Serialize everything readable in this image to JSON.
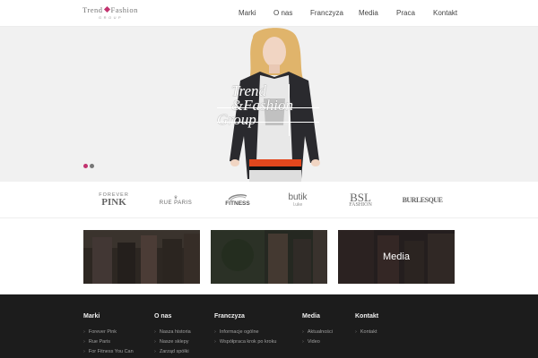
{
  "logo": {
    "word1": "Trend",
    "word2": "Fashion",
    "sub": "GROUP"
  },
  "nav": [
    {
      "label": "Marki"
    },
    {
      "label": "O nas"
    },
    {
      "label": "Franczyza"
    },
    {
      "label": "Media"
    },
    {
      "label": "Praca"
    },
    {
      "label": "Kontakt"
    }
  ],
  "hero": {
    "title_line1": "Trend",
    "title_line2": "&Fashion",
    "title_line3": "Group",
    "slider_dots": [
      {
        "state": "active",
        "color": "#c2336f"
      },
      {
        "state": "inactive",
        "color": "#777777"
      }
    ]
  },
  "brands": [
    {
      "line1": "FOREVER",
      "line2": "PINK"
    },
    {
      "line1": "RUE PARIS",
      "line2": ""
    },
    {
      "line1": "FITNESS",
      "line2": ""
    },
    {
      "line1": "butik",
      "line2": "l.uke"
    },
    {
      "line1": "BSL",
      "line2": "FASHION"
    },
    {
      "line1": "BURLESQUE",
      "line2": ""
    }
  ],
  "tiles": [
    {
      "label": ""
    },
    {
      "label": ""
    },
    {
      "label": "Media"
    }
  ],
  "footer": {
    "columns": [
      {
        "heading": "Marki",
        "links": [
          "Forever Pink",
          "Rue Paris",
          "For Fitness You Can"
        ]
      },
      {
        "heading": "O nas",
        "links": [
          "Nasza historia",
          "Nasze sklepy",
          "Zarząd spółki"
        ]
      },
      {
        "heading": "Franczyza",
        "links": [
          "Informacje ogólne",
          "Współpraca krok po kroku"
        ]
      },
      {
        "heading": "Media",
        "links": [
          "Aktualności",
          "Video"
        ]
      },
      {
        "heading": "Kontakt",
        "links": [
          "Kontakt"
        ]
      }
    ]
  },
  "colors": {
    "accent": "#c2336f",
    "footer_bg": "#1c1c1c",
    "hero_bg": "#f1f1f1"
  }
}
